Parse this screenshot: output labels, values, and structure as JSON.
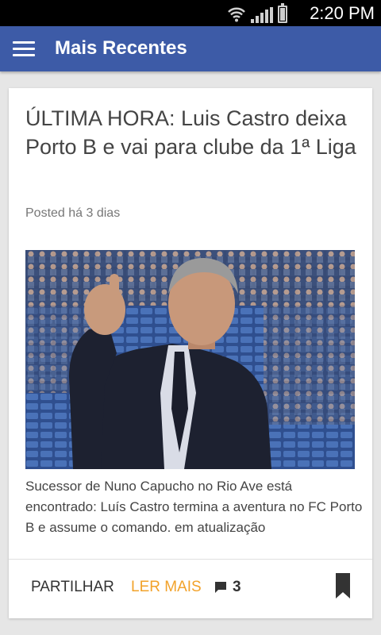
{
  "status_bar": {
    "time": "2:20 PM",
    "icons": [
      "wifi-icon",
      "signal-icon",
      "battery-icon"
    ]
  },
  "app_bar": {
    "title": "Mais Recentes",
    "menu_icon": "hamburger-menu-icon"
  },
  "article": {
    "headline": "ÚLTIMA HORA: Luis Castro deixa Porto B e vai para clube da 1ª Liga",
    "posted": "Posted há 3 dias",
    "excerpt": "Sucessor de Nuno Capucho no Rio Ave está encontrado: Luís Castro termina a aventura no FC Porto B e assume o comando. em atualização",
    "actions": {
      "share_label": "PARTILHAR",
      "read_more_label": "LER MAIS",
      "comment_count": "3"
    }
  },
  "colors": {
    "app_bar": "#3d5ba7",
    "accent": "#f2a22a",
    "background": "#e6e6e6"
  }
}
